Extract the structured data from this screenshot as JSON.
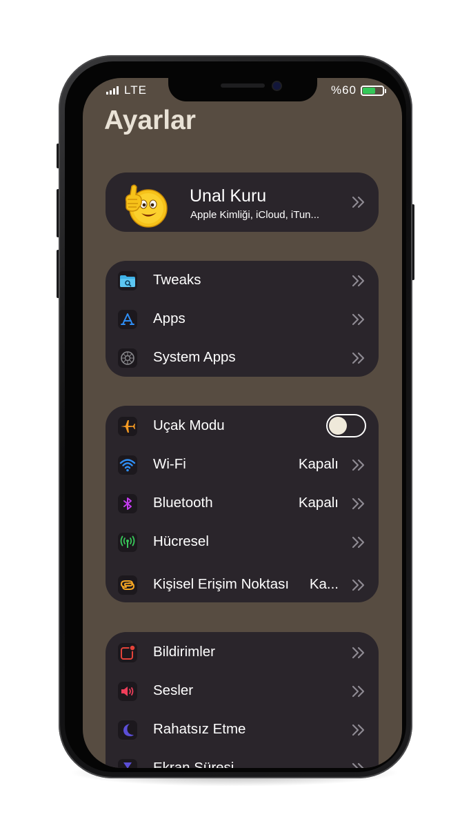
{
  "status_bar": {
    "carrier": "LTE",
    "battery_text": "%60",
    "battery_level": 0.6,
    "battery_color": "#34c759"
  },
  "page_title": "Ayarlar",
  "profile": {
    "name": "Unal Kuru",
    "subtitle": "Apple Kimliği, iCloud, iTun...",
    "avatar_icon": "thumbs-up-emoji"
  },
  "group1": [
    {
      "label": "Tweaks",
      "icon": "folder-search-icon"
    },
    {
      "label": "Apps",
      "icon": "app-store-icon"
    },
    {
      "label": "System Apps",
      "icon": "system-settings-icon"
    }
  ],
  "group2": {
    "airplane": {
      "label": "Uçak Modu",
      "toggle_on": false
    },
    "wifi": {
      "label": "Wi-Fi",
      "value": "Kapalı"
    },
    "bluetooth": {
      "label": "Bluetooth",
      "value": "Kapalı"
    },
    "cellular": {
      "label": "Hücresel"
    },
    "hotspot": {
      "label": "Kişisel Erişim Noktası",
      "value": "Ka..."
    }
  },
  "group3": [
    {
      "label": "Bildirimler",
      "icon": "notifications-icon"
    },
    {
      "label": "Sesler",
      "icon": "sounds-icon"
    },
    {
      "label": "Rahatsız Etme",
      "icon": "moon-icon"
    },
    {
      "label": "Ekran Süresi",
      "icon": "hourglass-icon"
    }
  ],
  "colors": {
    "screen_bg": "#574c41",
    "card_bg": "#2a252b",
    "title_color": "#e9e2d6"
  }
}
